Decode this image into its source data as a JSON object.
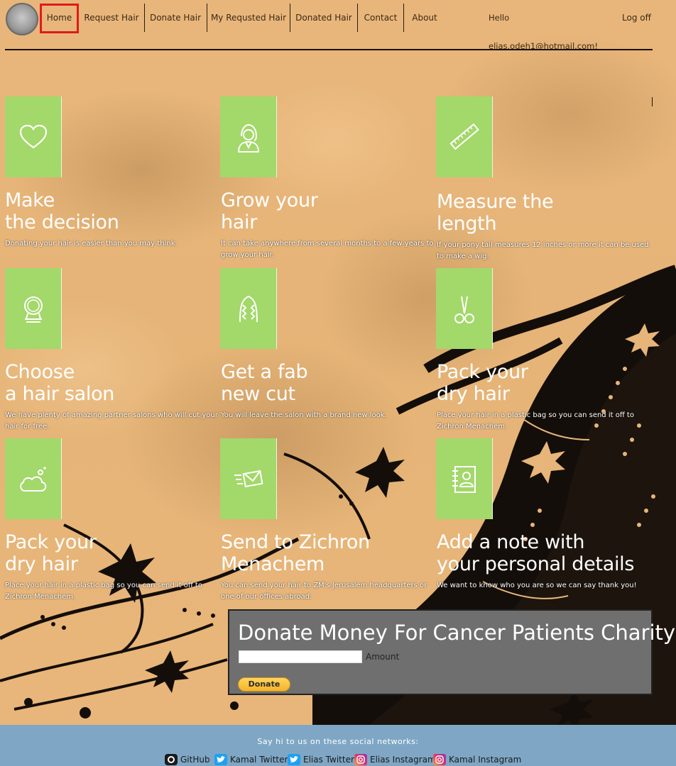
{
  "nav": {
    "items": [
      {
        "label": "Home"
      },
      {
        "label": "Request Hair"
      },
      {
        "label": "Donate Hair"
      },
      {
        "label": "My Requsted Hair"
      },
      {
        "label": "Donated Hair"
      },
      {
        "label": "Contact"
      },
      {
        "label": "About"
      }
    ],
    "greeting": "Hello elias.odeh1@hotmail.com!",
    "logoff": "Log off"
  },
  "steps": [
    {
      "icon": "heart-icon",
      "title": "Make\nthe decision",
      "desc": "Donating your hair is easier than you may think."
    },
    {
      "icon": "woman-icon",
      "title": "Grow your\nhair",
      "desc": "It can take anywhere from several months to a few years to grow your hair."
    },
    {
      "icon": "ruler-icon",
      "title": "Measure the\nlength",
      "desc": "If your pony tail measures 12 inches or more it can be used to make a wig."
    },
    {
      "icon": "mirror-icon",
      "title": "Choose\na hair salon",
      "desc": "We have plenty of amazing partner salons who will cut your hair for free."
    },
    {
      "icon": "braids-icon",
      "title": "Get a fab\nnew cut",
      "desc": "You will leave the salon with a brand new look."
    },
    {
      "icon": "scissors-icon",
      "title": "Pack your\ndry hair",
      "desc": "Place your hair in a plastic bag so you can send it off to Zichron Menachem."
    },
    {
      "icon": "bubbles-icon",
      "title": "Pack your\ndry hair",
      "desc": "Place your hair in a plastic bag so you can send it off to Zichron Menachem."
    },
    {
      "icon": "send-mail-icon",
      "title": "Send to Zichron\nMenachem",
      "desc": "You can send your hair to ZM's Jerusalem headquarters or one of our offices abroad."
    },
    {
      "icon": "address-book-icon",
      "title": "Add a note with\nyour personal details",
      "desc": "We want to know who you are so we can say thank you!"
    }
  ],
  "donate": {
    "title": "Donate Money For Cancer Patients Charity",
    "amount_label": "Amount",
    "amount_value": "",
    "button": "Donate"
  },
  "footer": {
    "text": "Say hi to us on these social networks:",
    "links": [
      {
        "label": "GitHub",
        "icon": "github-icon"
      },
      {
        "label": "Kamal Twitter",
        "icon": "twitter-icon"
      },
      {
        "label": "Elias Twitter",
        "icon": "twitter-icon"
      },
      {
        "label": "Elias Instagram",
        "icon": "instagram-icon"
      },
      {
        "label": "Kamal Instagram",
        "icon": "instagram-icon"
      }
    ]
  },
  "colors": {
    "tile": "#a3d86a",
    "footer": "#7fa7c5",
    "highlight": "#e11a1a",
    "donate_box": "#6f6f6f",
    "paypal": "#ffc439"
  }
}
